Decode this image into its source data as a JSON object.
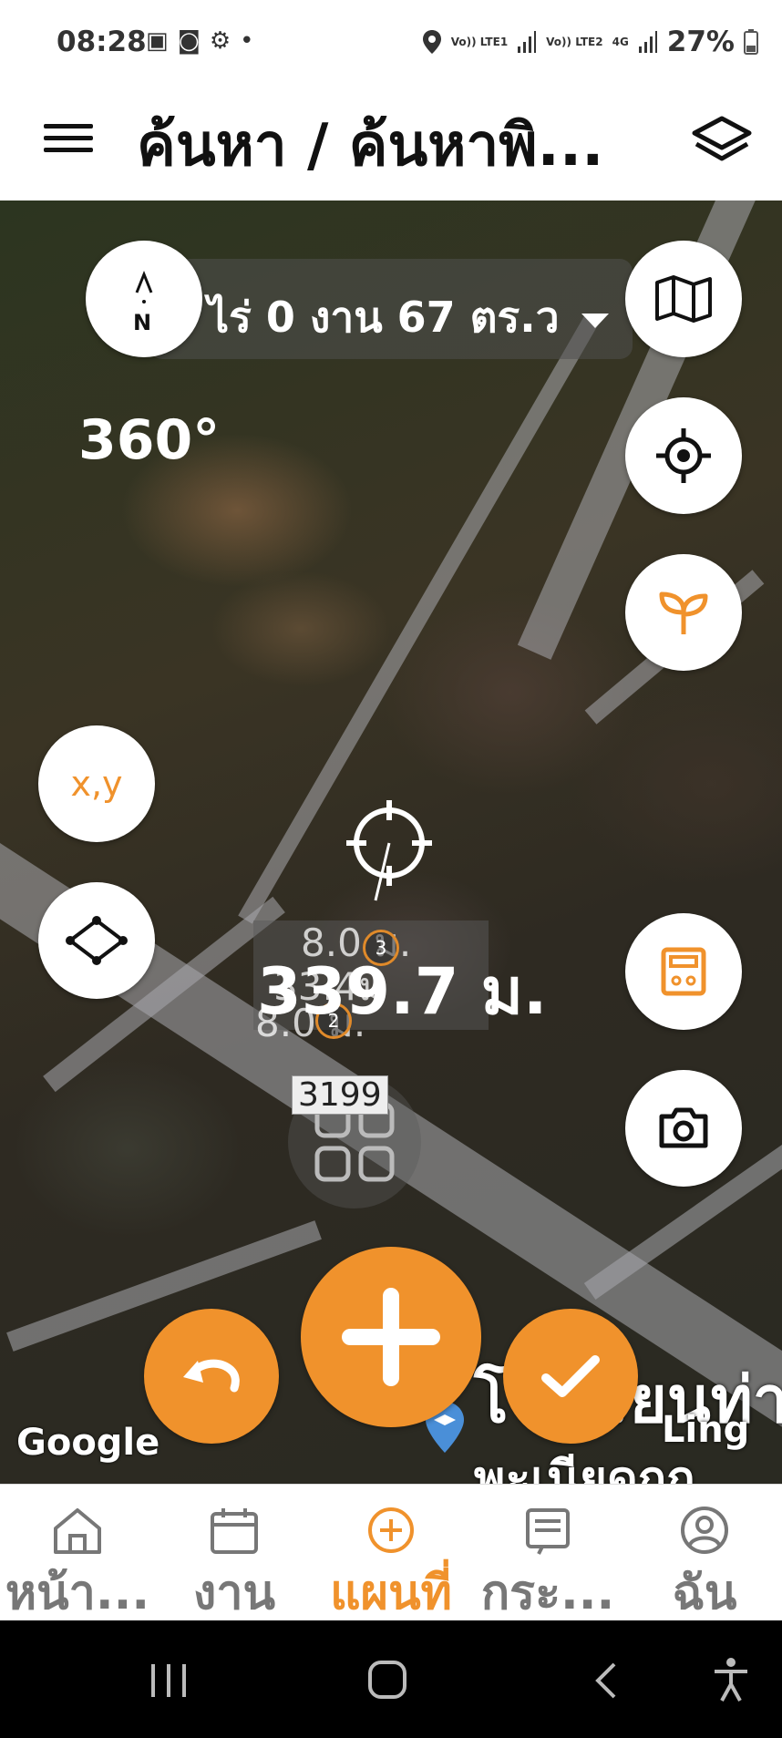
{
  "status_bar": {
    "time": "08:28",
    "net1": "Vo)) LTE1",
    "net2": "Vo)) LTE2",
    "net_gen": "4G",
    "battery": "27%"
  },
  "header": {
    "title": "ค้นหา / ค้นหาพิ..."
  },
  "map": {
    "area": "0 ไร่ 0 งาน 67 ตร.ว",
    "bearing": "360°",
    "compass_letter": "N",
    "coord_button": "x,y",
    "distance": "339.7 ม.",
    "segment_top": "8.0 ม.",
    "segment_bottom": "8.0 ม.",
    "segment_mid": "33.4ม",
    "point_labels": [
      "3",
      "2"
    ],
    "code_label": "3199",
    "google": "Google",
    "place_line1": "โรงเรียนท่า",
    "place_line2": "Ling",
    "place_line3": "พะเนียดกก"
  },
  "bottom_nav": {
    "items": [
      {
        "label": "หน้า...",
        "icon": "home-icon"
      },
      {
        "label": "งาน",
        "icon": "calendar-icon"
      },
      {
        "label": "แผนที่",
        "icon": "plus-circle-icon"
      },
      {
        "label": "กระ...",
        "icon": "board-icon"
      },
      {
        "label": "ฉัน",
        "icon": "user-icon"
      }
    ],
    "active_index": 2
  },
  "colors": {
    "accent": "#f0922c",
    "text_dark": "#111111",
    "nav_inactive": "#777777"
  }
}
